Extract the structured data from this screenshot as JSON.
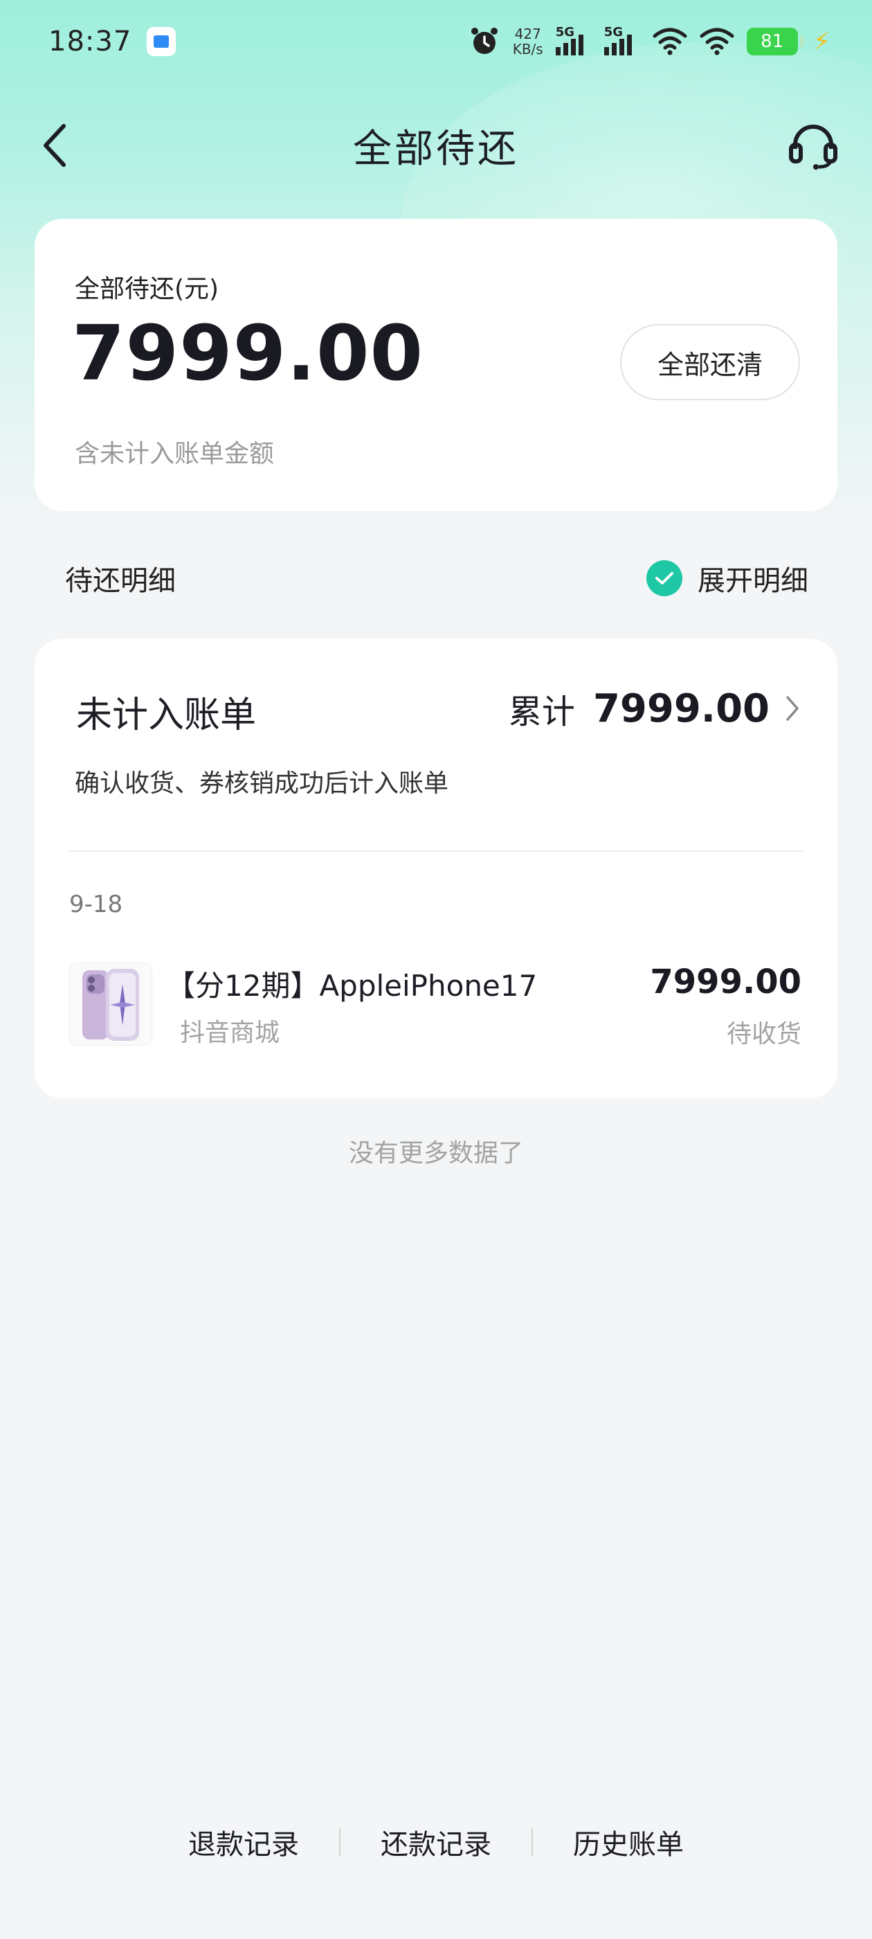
{
  "status_bar": {
    "time": "18:37",
    "net_speed_value": "427",
    "net_speed_unit": "KB/s",
    "signal1_label": "5G",
    "signal2_label": "5G",
    "battery": "81",
    "charging_color": "#f2c21a"
  },
  "header": {
    "title": "全部待还",
    "back_icon": "chevron-left-icon",
    "support_icon": "headset-icon"
  },
  "summary": {
    "label": "全部待还(元)",
    "amount": "7999.00",
    "note": "含未计入账单金额",
    "payoff_button": "全部还清"
  },
  "details_section": {
    "title": "待还明细",
    "expand_label": "展开明细",
    "expand_checked": true,
    "accent_color": "#1ec8a5"
  },
  "bill": {
    "title": "未计入账单",
    "total_label": "累计",
    "total_value": "7999.00",
    "description": "确认收货、券核销成功后计入账单",
    "date": "9-18",
    "order": {
      "name": "【分12期】AppleiPhone17",
      "shop": "抖音商城",
      "amount": "7999.00",
      "status": "待收货"
    }
  },
  "no_more_text": "没有更多数据了",
  "bottom_links": {
    "refund_records": "退款记录",
    "repayment_records": "还款记录",
    "history_bills": "历史账单"
  }
}
